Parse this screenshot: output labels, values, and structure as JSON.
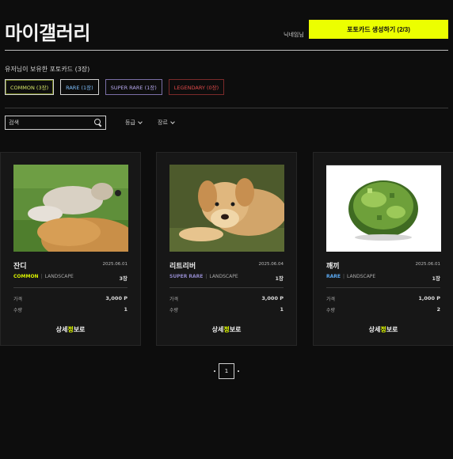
{
  "header": {
    "title": "마이갤러리",
    "nickname": "닉네임님",
    "create_button": "포토카드 생성하기 (2/3)"
  },
  "owned_label": "유저님이 보유한 포토카드 (3장)",
  "grade_filters": [
    {
      "label": "COMMON (3장)",
      "key": "common"
    },
    {
      "label": "RARE (1장)",
      "key": "rare"
    },
    {
      "label": "SUPER RARE (1장)",
      "key": "superrare"
    },
    {
      "label": "LEGENDARY (0장)",
      "key": "legendary"
    }
  ],
  "search": {
    "placeholder": "검색"
  },
  "filters": {
    "grade": "등급",
    "genre": "장르"
  },
  "cards": [
    {
      "name": "잔디",
      "date": "2025.06.01",
      "grade": "COMMON",
      "genre": "LANDSCAPE",
      "count": "3장",
      "price_label": "가격",
      "price": "3,000 P",
      "qty_label": "수량",
      "qty": "1",
      "buy_prefix": "상세",
      "buy_hl": "정",
      "buy_suffix": "보로"
    },
    {
      "name": "리트리버",
      "date": "2025.06.04",
      "grade": "SUPER RARE",
      "genre": "LANDSCAPE",
      "count": "1장",
      "price_label": "가격",
      "price": "3,000 P",
      "qty_label": "수량",
      "qty": "1",
      "buy_prefix": "상세",
      "buy_hl": "정",
      "buy_suffix": "보로"
    },
    {
      "name": "깨끼",
      "date": "2025.06.01",
      "grade": "RARE",
      "genre": "LANDSCAPE",
      "count": "1장",
      "price_label": "가격",
      "price": "1,000 P",
      "qty_label": "수량",
      "qty": "2",
      "buy_prefix": "상세",
      "buy_hl": "정",
      "buy_suffix": "보로"
    }
  ],
  "pagination": {
    "current": "1"
  },
  "colors": {
    "accent": "#ecff00",
    "background": "#0d0d0d",
    "card": "#171717",
    "common": "#d7f000",
    "rare": "#5aa8f0",
    "superrare": "#8f86c7",
    "legendary": "#e04a4a"
  }
}
